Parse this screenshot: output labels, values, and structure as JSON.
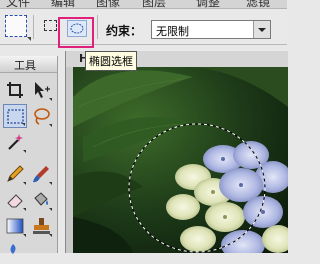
{
  "menu": {
    "items": [
      "文件",
      "编辑",
      "图像",
      "图层",
      "调整",
      "滤镜"
    ]
  },
  "options_bar": {
    "constrain_label": "约束：",
    "constrain_value": "无限制",
    "tooltip": "椭圆选框"
  },
  "tools_panel": {
    "title": "工具"
  },
  "document": {
    "title_letter": "H"
  },
  "colors": {
    "highlight": "#e0207a",
    "tool_active_bg": "#c9d7ee",
    "canvas_dark": "#142d12"
  }
}
